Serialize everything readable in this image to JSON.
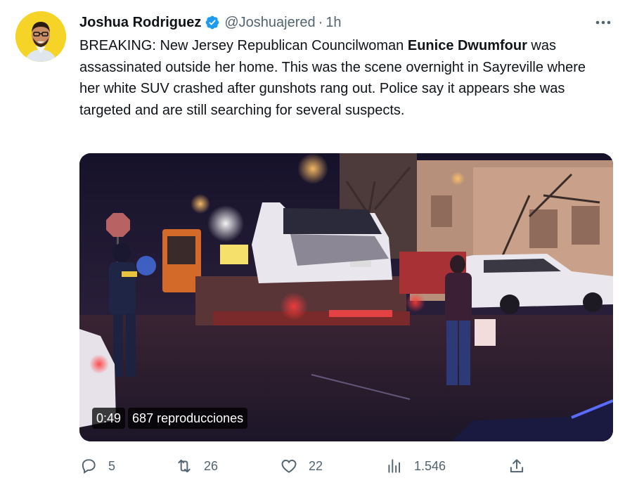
{
  "tweet": {
    "author": {
      "display_name": "Joshua Rodriguez",
      "handle": "@Joshuajered",
      "separator": "·",
      "time": "1h",
      "verified_icon": "verified-badge-icon",
      "avatar_bg": "#f5d327"
    },
    "text": {
      "part1": "BREAKING: New Jersey Republican Councilwoman ",
      "bold_name": "Eunice Dwumfour",
      "part2": " was assassinated outside her home. This was the scene overnight in Sayreville where her white SUV crashed after gunshots rang out. Police say it appears she was targeted and are still searching for several suspects."
    },
    "media": {
      "duration": "0:49",
      "views": "687 reproducciones"
    },
    "actions": {
      "replies": "5",
      "retweets": "26",
      "likes": "22",
      "views": "1.546"
    }
  },
  "colors": {
    "text": "#0f1419",
    "secondary": "#536471",
    "verified": "#1d9bf0"
  }
}
